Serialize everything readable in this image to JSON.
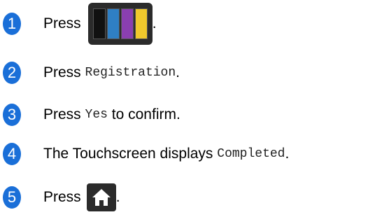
{
  "steps": [
    {
      "number": "1",
      "prefix": "Press",
      "suffix": "."
    },
    {
      "number": "2",
      "prefix": "Press",
      "code": "Registration",
      "suffix": "."
    },
    {
      "number": "3",
      "prefix": "Press",
      "code": "Yes",
      "suffix": "to confirm."
    },
    {
      "number": "4",
      "prefix": "The Touchscreen displays",
      "code": "Completed",
      "suffix": "."
    },
    {
      "number": "5",
      "prefix": "Press",
      "suffix": "."
    }
  ],
  "icons": {
    "ink_icon": "ink-cartridge-icon",
    "home_icon": "home-icon",
    "ink_colors": [
      "#111111",
      "#2f7fc4",
      "#8a3fb0",
      "#f0c92c"
    ]
  }
}
